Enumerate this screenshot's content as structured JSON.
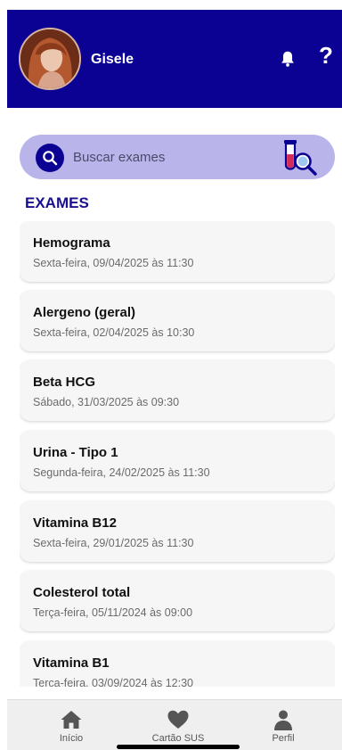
{
  "header": {
    "username": "Gisele",
    "help_label": "?",
    "icons": {
      "bell": "bell-icon",
      "avatar": "user-avatar"
    }
  },
  "search": {
    "placeholder": "Buscar exames",
    "icon": "search-icon",
    "lab_icon": "test-tube-magnifier-icon"
  },
  "section_title": "EXAMES",
  "exams": [
    {
      "name": "Hemograma",
      "date": "Sexta-feira, 09/04/2025 às 11:30"
    },
    {
      "name": "Alergeno (geral)",
      "date": "Sexta-feira, 02/04/2025 às 10:30"
    },
    {
      "name": "Beta HCG",
      "date": "Sábado, 31/03/2025 às 09:30"
    },
    {
      "name": "Urina - Tipo 1",
      "date": "Segunda-feira, 24/02/2025 às 11:30"
    },
    {
      "name": "Vitamina B12",
      "date": "Sexta-feira, 29/01/2025 às 11:30"
    },
    {
      "name": "Colesterol total",
      "date": "Terça-feira, 05/11/2024 às 09:00"
    },
    {
      "name": "Vitamina B1",
      "date": "Terca-feira, 03/09/2024 às 12:30"
    }
  ],
  "nav": [
    {
      "label": "Início",
      "icon": "home-icon"
    },
    {
      "label": "Cartão SUS",
      "icon": "heart-icon"
    },
    {
      "label": "Perfil",
      "icon": "person-icon"
    }
  ],
  "colors": {
    "primary": "#0b0294",
    "search_bg": "#b9b4ea",
    "title": "#1a0f8f"
  }
}
